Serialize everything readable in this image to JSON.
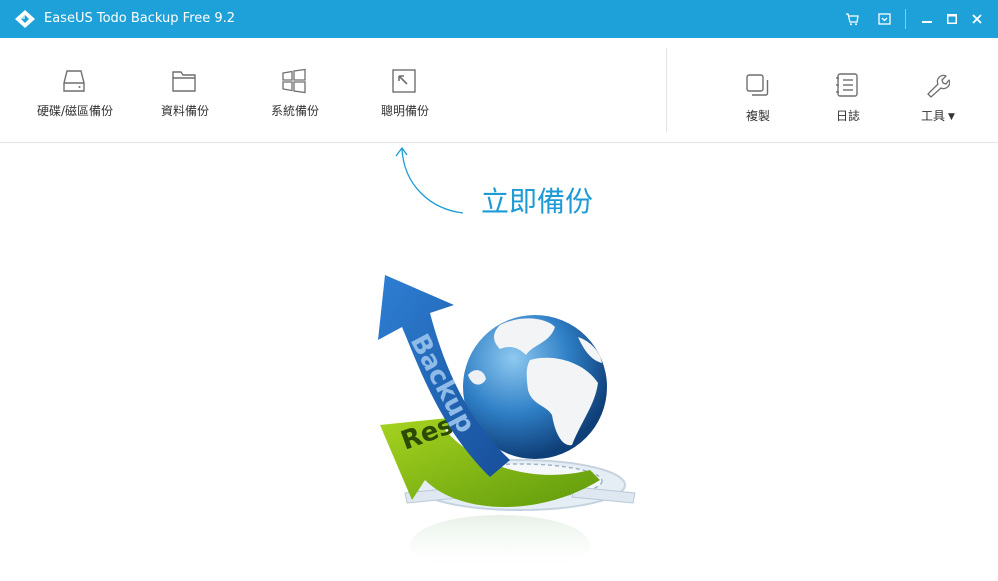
{
  "window": {
    "title": "EaseUS Todo Backup Free 9.2",
    "buttons": [
      "cart-icon",
      "update-icon",
      "minimize-icon",
      "maximize-icon",
      "close-icon"
    ]
  },
  "toolbar": {
    "left_items": [
      {
        "label": "硬碟/磁區備份",
        "icon": "disk-icon"
      },
      {
        "label": "資料備份",
        "icon": "folder-icon"
      },
      {
        "label": "系統備份",
        "icon": "windows-icon"
      },
      {
        "label": "聰明備份",
        "icon": "smart-backup-icon"
      }
    ],
    "right_items": [
      {
        "label": "複製",
        "icon": "clone-icon"
      },
      {
        "label": "日誌",
        "icon": "log-icon"
      },
      {
        "label": "工具",
        "icon": "wrench-icon"
      }
    ]
  },
  "main": {
    "hint_text": "立即備份",
    "illustration": {
      "arrow_blue_text": "Backup",
      "arrow_green_text": "Restore"
    }
  },
  "colors": {
    "titlebar": "#1da1d8",
    "accent_text": "#1e9bd6",
    "icon_gray": "#6f6f6f"
  }
}
